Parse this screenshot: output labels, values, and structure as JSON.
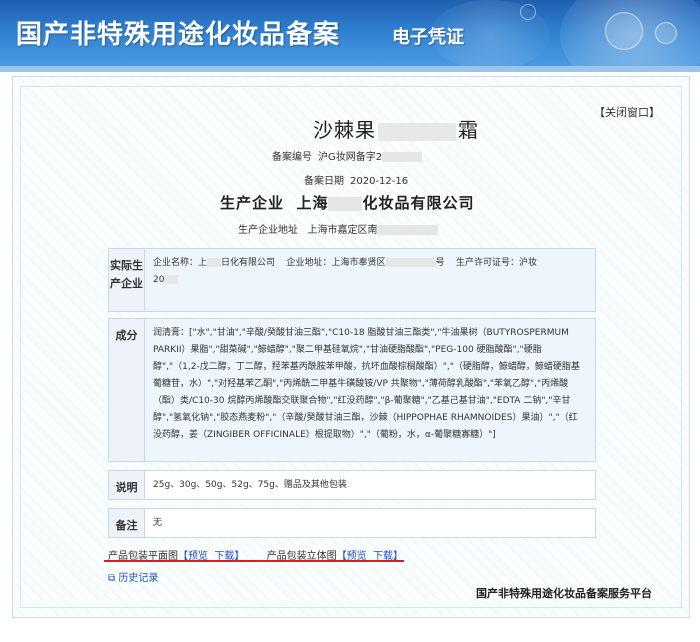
{
  "header": {
    "title": "国产非特殊用途化妆品备案",
    "subtitle": "电子凭证"
  },
  "certificate": {
    "close_label": "【关闭窗口】",
    "product_name_prefix": "沙棘果",
    "product_name_suffix": "霜",
    "record_no_label": "备案编号",
    "record_no_value": "沪G妆网备字2",
    "record_date_label": "备案日期",
    "record_date_value": "2020-12-16",
    "company_label": "生产企业",
    "company_prefix": "上海",
    "company_suffix": "化妆品有限公司",
    "company_address_label": "生产企业地址",
    "company_address_value": "上海市嘉定区南"
  },
  "actual_producer": {
    "label": "实际生产企业",
    "name_label": "企业名称：上",
    "name_value": "日化有限公司",
    "address_label": "企业地址：上海市奉贤区",
    "address_suffix": "号",
    "license_label": "生产许可证号：沪妆",
    "license_value": "20"
  },
  "ingredients": {
    "label": "成分",
    "text": "润清膏：[\"水\",\"甘油\",\"辛酸/癸酸甘油三酯\",\"C10-18 脂酸甘油三酯类\",\"牛油果树（BUTYROSPERMUM PARKII）果脂\",\"甜菜碱\",\"鲸蜡醇\",\"聚二甲基硅氧烷\",\"甘油硬脂酸酯\",\"PEG-100 硬脂酸酯\",\"硬脂醇\",\"（1,2-戊二醇，丁二醇，羟苯基丙酰胺苯甲酸，抗坏血酸棕榈酸酯）\",\"（硬脂醇，鲸蜡醇，鲸蜡硬脂基葡糖苷，水）\",\"对羟基苯乙酮\",\"丙烯酰二甲基牛磺酸铵/VP 共聚物\",\"薄荷醇乳酸酯\",\"苯氧乙醇\",\"丙烯酸（酯）类/C10-30 烷醇丙烯酸酯交联聚合物\",\"红没药醇\",\"β-葡聚糖\",\"乙基己基甘油\",\"EDTA 二钠\",\"辛甘醇\",\"氢氧化钠\",\"胶态燕麦粉\",\"（辛酸/癸酸甘油三酯，沙棘（HIPPOPHAE RHAMNOIDES）果油）\",\"（红没药醇，姜（ZINGIBER OFFICINALE）根提取物）\",\"（葡粉，水，α-葡聚糖寡糖）\"]"
  },
  "description": {
    "label": "说明",
    "text": "25g、30g、50g、52g、75g、赠品及其他包装"
  },
  "remarks": {
    "label": "备注",
    "text": "无"
  },
  "package_links": {
    "flat_label": "产品包装平面图",
    "flat_preview": "【预览",
    "flat_download": "下载】",
    "stereo_label": "产品包装立体图",
    "stereo_preview": "【预览",
    "stereo_download": "下载】"
  },
  "history_label": "历史记录",
  "footer_org": "国产非特殊用途化妆品备案服务平台",
  "colors": {
    "banner": "#2f7fd0",
    "link": "#1a50c8",
    "underline": "#d81e1e",
    "label_bg": "#eef3f9"
  }
}
